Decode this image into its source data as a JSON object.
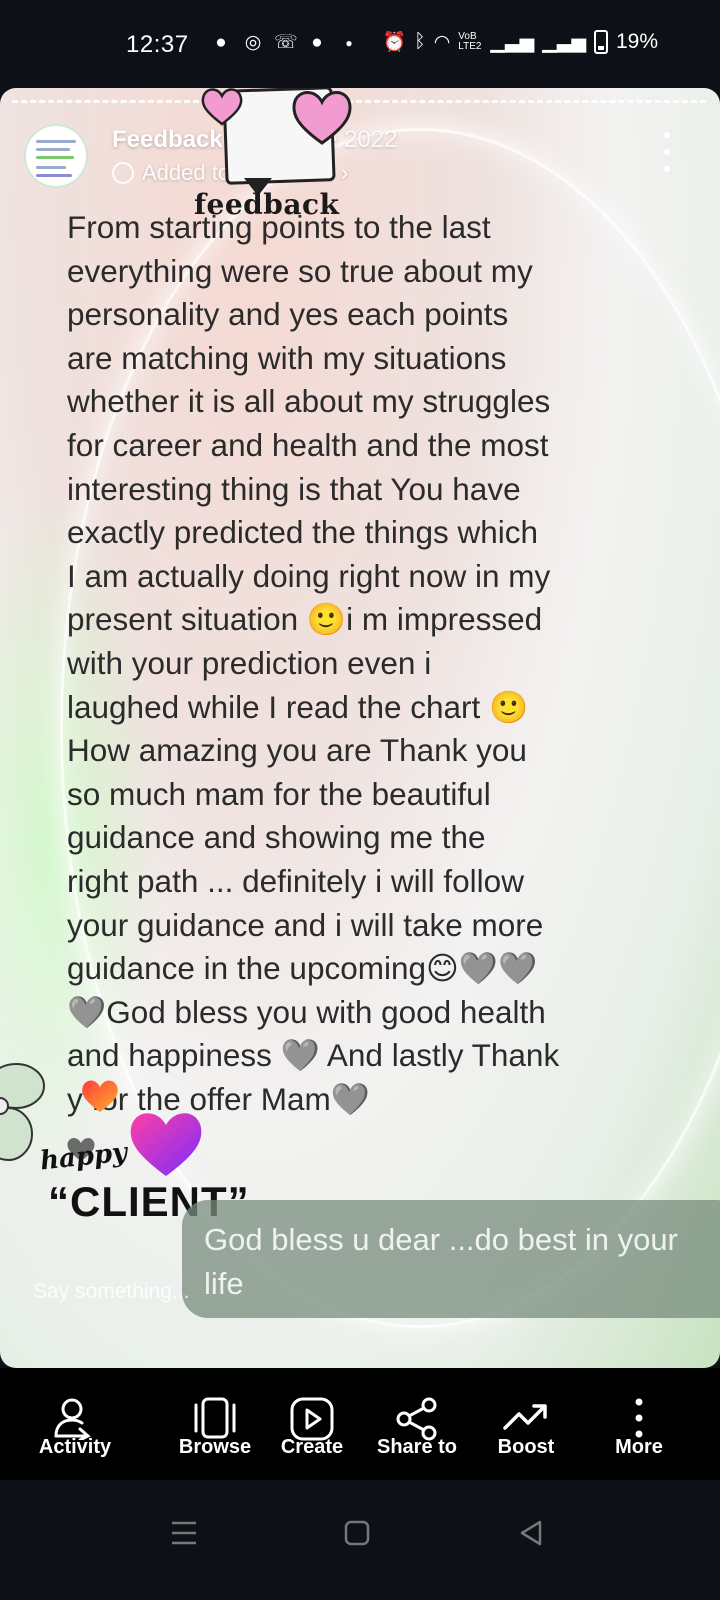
{
  "status_bar": {
    "time": "12:37",
    "battery": "19%",
    "network_label": "VoB LTE2",
    "notification_icons": [
      "chat-bubble-icon",
      "whatsapp-icon",
      "missed-call-icon",
      "message-icon"
    ],
    "system_icons": [
      "alarm-icon",
      "bluetooth-icon",
      "wifi-icon",
      "signal-icon",
      "signal-icon",
      "battery-icon"
    ]
  },
  "story": {
    "title": "Feedback",
    "date": "27 June 2022",
    "added_to": "Added to Feedback",
    "sticker_word": "feedback",
    "message": "From starting  points to the last\neverything were so true about my\npersonality and yes each points\nare matching with my situations\nwhether it is all about my struggles\nfor  career and health and the most\ninteresting thing is that You have\nexactly predicted the things which\nI am actually doing right now in my\npresent situation 🙂i m impressed\nwith your prediction even i\nlaughed while I read the chart 🙂\nHow amazing you are Thank you\nso much mam for the beautiful\nguidance and showing me the\nright path ... definitely i will follow\nyour guidance and i will take more\nguidance in the upcoming😊🩶🩶\n🩶God bless you with good health\nand happiness 🩶 And lastly Thank\ny   for the offer Mam🩶",
    "happy_word": "happy",
    "client_word": "“CLIENT”",
    "reply_text": "God bless u dear ...do best in your life",
    "comment_placeholder": "Say something..."
  },
  "actions": [
    {
      "label": "Activity",
      "icon": "activity-icon"
    },
    {
      "label": "Browse",
      "icon": "browse-icon"
    },
    {
      "label": "Create",
      "icon": "create-icon"
    },
    {
      "label": "Share to",
      "icon": "share-icon"
    },
    {
      "label": "Boost",
      "icon": "boost-icon"
    },
    {
      "label": "More",
      "icon": "more-vertical-icon"
    }
  ],
  "nav": [
    "recent-apps-icon",
    "home-icon",
    "back-icon"
  ],
  "colors": {
    "background": "#0d1016",
    "text_dark": "#2b2b2b",
    "heart_pink": "#f29bd0",
    "heart_gradient_start": "#ff3fa4",
    "heart_gradient_end": "#7a2cff"
  }
}
